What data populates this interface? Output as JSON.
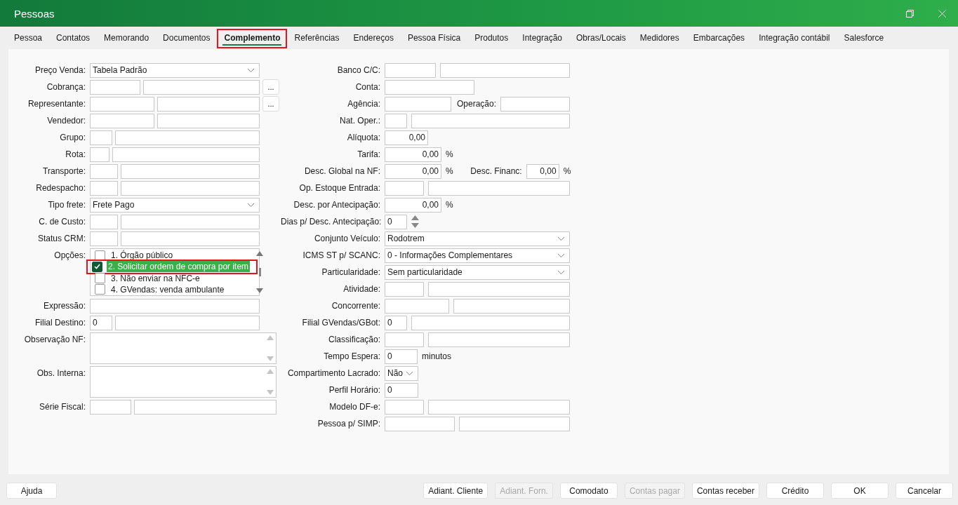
{
  "window": {
    "title": "Pessoas"
  },
  "tabs": [
    {
      "label": "Pessoa",
      "selected": false,
      "annotated": false
    },
    {
      "label": "Contatos",
      "selected": false,
      "annotated": false
    },
    {
      "label": "Memorando",
      "selected": false,
      "annotated": false
    },
    {
      "label": "Documentos",
      "selected": false,
      "annotated": false
    },
    {
      "label": "Complemento",
      "selected": true,
      "annotated": true
    },
    {
      "label": "Referências",
      "selected": false,
      "annotated": false
    },
    {
      "label": "Endereços",
      "selected": false,
      "annotated": false
    },
    {
      "label": "Pessoa Física",
      "selected": false,
      "annotated": false
    },
    {
      "label": "Produtos",
      "selected": false,
      "annotated": false
    },
    {
      "label": "Integração",
      "selected": false,
      "annotated": false
    },
    {
      "label": "Obras/Locais",
      "selected": false,
      "annotated": false
    },
    {
      "label": "Medidores",
      "selected": false,
      "annotated": false
    },
    {
      "label": "Embarcações",
      "selected": false,
      "annotated": false
    },
    {
      "label": "Integração contábil",
      "selected": false,
      "annotated": false
    },
    {
      "label": "Salesforce",
      "selected": false,
      "annotated": false
    }
  ],
  "form": {
    "left": [
      {
        "label": "Preço Venda:",
        "fields": [
          {
            "kind": "select",
            "value": "Tabela Padrão"
          }
        ]
      },
      {
        "label": "Cobrança:",
        "fields": [
          {
            "kind": "text"
          },
          {
            "kind": "text"
          },
          {
            "kind": "button",
            "text": "..."
          }
        ]
      },
      {
        "label": "Representante:",
        "fields": [
          {
            "kind": "text"
          },
          {
            "kind": "text"
          },
          {
            "kind": "button",
            "text": "..."
          }
        ]
      },
      {
        "label": "Vendedor:",
        "fields": [
          {
            "kind": "text"
          },
          {
            "kind": "text"
          }
        ]
      },
      {
        "label": "Grupo:",
        "fields": [
          {
            "kind": "text"
          },
          {
            "kind": "text"
          }
        ]
      },
      {
        "label": "Rota:",
        "fields": [
          {
            "kind": "text"
          },
          {
            "kind": "text"
          }
        ]
      },
      {
        "label": "Transporte:",
        "fields": [
          {
            "kind": "text"
          },
          {
            "kind": "text"
          }
        ]
      },
      {
        "label": "Redespacho:",
        "fields": [
          {
            "kind": "text"
          },
          {
            "kind": "text"
          }
        ]
      },
      {
        "label": "Tipo frete:",
        "fields": [
          {
            "kind": "select",
            "value": "Frete Pago"
          }
        ]
      },
      {
        "label": "C. de Custo:",
        "fields": [
          {
            "kind": "text"
          },
          {
            "kind": "text"
          }
        ]
      },
      {
        "label": "Status CRM:",
        "fields": [
          {
            "kind": "text"
          },
          {
            "kind": "text"
          }
        ]
      },
      {
        "label": "Opções:",
        "fields": [
          {
            "kind": "checklist",
            "items": [
              {
                "text": "1. Órgão público",
                "checked": false,
                "selected": false,
                "annotated": false
              },
              {
                "text": "2. Solicitar ordem de compra por item",
                "checked": true,
                "selected": true,
                "annotated": true
              },
              {
                "text": "3. Não enviar na NFC-e",
                "checked": false,
                "selected": false,
                "annotated": false
              },
              {
                "text": "4. GVendas: venda ambulante",
                "checked": false,
                "selected": false,
                "annotated": false
              }
            ]
          }
        ]
      },
      {
        "label": "Expressão:",
        "fields": [
          {
            "kind": "text"
          }
        ]
      },
      {
        "label": "Filial Destino:",
        "fields": [
          {
            "kind": "text",
            "value": "0"
          },
          {
            "kind": "text"
          }
        ]
      },
      {
        "label": "Observação NF:",
        "fields": [
          {
            "kind": "memo"
          }
        ]
      },
      {
        "label": "Obs. Interna:",
        "fields": [
          {
            "kind": "memo"
          }
        ]
      },
      {
        "label": "Série Fiscal:",
        "fields": [
          {
            "kind": "text"
          },
          {
            "kind": "text"
          }
        ]
      }
    ],
    "right": [
      {
        "label": "Banco C/C:",
        "fields": [
          {
            "kind": "text"
          },
          {
            "kind": "text"
          }
        ]
      },
      {
        "label": "Conta:",
        "fields": [
          {
            "kind": "text"
          }
        ]
      },
      {
        "label": "Agência:",
        "fields": [
          {
            "kind": "text"
          },
          {
            "kind": "label",
            "text": "Operação:"
          },
          {
            "kind": "text"
          }
        ]
      },
      {
        "label": "Nat. Oper.:",
        "fields": [
          {
            "kind": "text"
          },
          {
            "kind": "text"
          }
        ]
      },
      {
        "label": "Alíquota:",
        "fields": [
          {
            "kind": "number",
            "value": "0,00"
          }
        ]
      },
      {
        "label": "Tarifa:",
        "fields": [
          {
            "kind": "number",
            "value": "0,00"
          },
          {
            "kind": "unit",
            "text": "%"
          }
        ]
      },
      {
        "label": "Desc. Global na NF:",
        "fields": [
          {
            "kind": "number",
            "value": "0,00"
          },
          {
            "kind": "unit",
            "text": "%"
          },
          {
            "kind": "label",
            "text": "Desc. Financ:"
          },
          {
            "kind": "number",
            "value": "0,00"
          },
          {
            "kind": "unit",
            "text": "%"
          }
        ]
      },
      {
        "label": "Op. Estoque Entrada:",
        "fields": [
          {
            "kind": "text"
          },
          {
            "kind": "text"
          }
        ]
      },
      {
        "label": "Desc. por Antecipação:",
        "fields": [
          {
            "kind": "number",
            "value": "0,00"
          },
          {
            "kind": "unit",
            "text": "%"
          }
        ]
      },
      {
        "label": "Dias p/ Desc. Antecipação:",
        "fields": [
          {
            "kind": "spinner",
            "value": "0"
          }
        ]
      },
      {
        "label": "Conjunto Veículo:",
        "fields": [
          {
            "kind": "select",
            "value": "Rodotrem"
          }
        ]
      },
      {
        "label": "ICMS ST p/ SCANC:",
        "fields": [
          {
            "kind": "select",
            "value": "0 - Informações Complementares"
          }
        ]
      },
      {
        "label": "Particularidade:",
        "fields": [
          {
            "kind": "select",
            "value": "Sem particularidade"
          }
        ]
      },
      {
        "label": "Atividade:",
        "fields": [
          {
            "kind": "text"
          },
          {
            "kind": "text"
          }
        ]
      },
      {
        "label": "Concorrente:",
        "fields": [
          {
            "kind": "text"
          },
          {
            "kind": "text"
          }
        ]
      },
      {
        "label": "Filial GVendas/GBot:",
        "fields": [
          {
            "kind": "text",
            "value": "0"
          },
          {
            "kind": "text"
          }
        ]
      },
      {
        "label": "Classificação:",
        "fields": [
          {
            "kind": "text"
          },
          {
            "kind": "text"
          }
        ]
      },
      {
        "label": "Tempo Espera:",
        "fields": [
          {
            "kind": "text",
            "value": "0"
          },
          {
            "kind": "unit",
            "text": "minutos"
          }
        ]
      },
      {
        "label": "Compartimento Lacrado:",
        "fields": [
          {
            "kind": "select",
            "value": "Não"
          }
        ]
      },
      {
        "label": "Perfil Horário:",
        "fields": [
          {
            "kind": "text",
            "value": "0"
          }
        ]
      },
      {
        "label": "Modelo DF-e:",
        "fields": [
          {
            "kind": "text"
          },
          {
            "kind": "text"
          }
        ]
      },
      {
        "label": "Pessoa p/ SIMP:",
        "fields": [
          {
            "kind": "text"
          },
          {
            "kind": "text"
          }
        ]
      }
    ]
  },
  "footer": {
    "left_buttons": [
      {
        "label": "Ajuda",
        "disabled": false
      }
    ],
    "right_buttons": [
      {
        "label": "Adiant. Cliente",
        "disabled": false
      },
      {
        "label": "Adiant. Forn.",
        "disabled": true
      },
      {
        "label": "Comodato",
        "disabled": false
      },
      {
        "label": "Contas pagar",
        "disabled": true
      },
      {
        "label": "Contas receber",
        "disabled": false
      },
      {
        "label": "Crédito",
        "disabled": false
      },
      {
        "label": "OK",
        "disabled": false
      },
      {
        "label": "Cancelar",
        "disabled": false
      }
    ]
  }
}
